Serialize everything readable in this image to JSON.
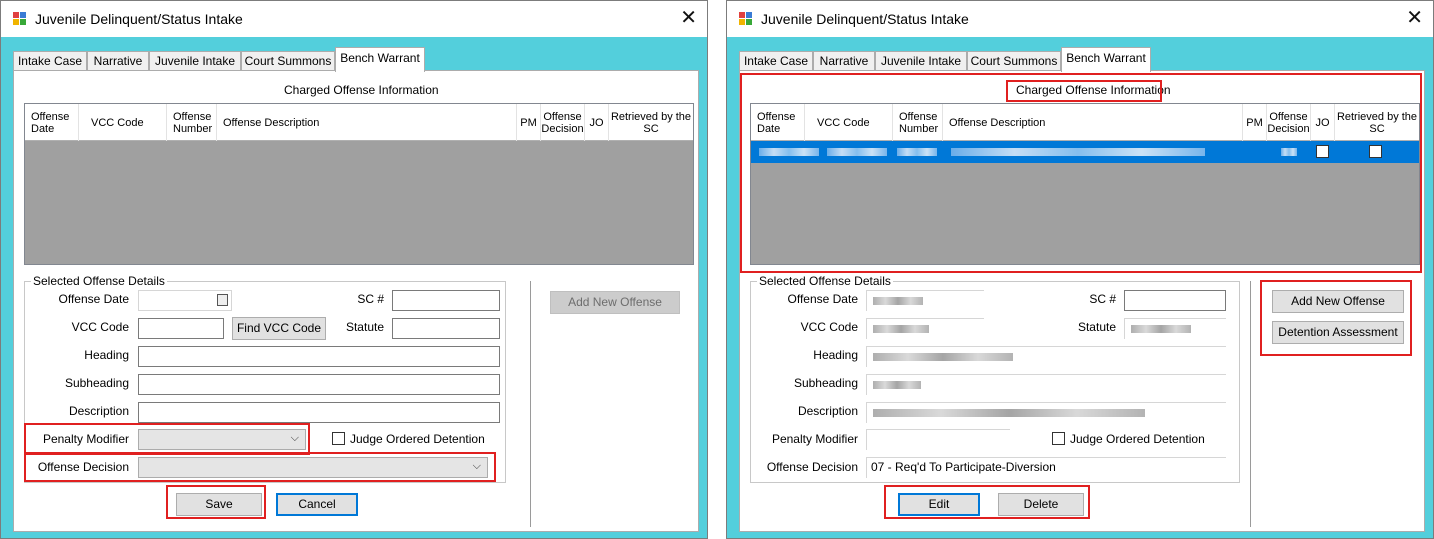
{
  "window_title": "Juvenile Delinquent/Status Intake",
  "close_glyph": "✕",
  "tabs": [
    "Intake Case",
    "Narrative",
    "Juvenile Intake",
    "Court Summons",
    "Bench Warrant"
  ],
  "active_tab": "Bench Warrant",
  "offense_group_title": "Charged Offense Information",
  "grid_columns": {
    "offense_date": "Offense Date",
    "vcc_code": "VCC Code",
    "offense_number": "Offense Number",
    "offense_description": "Offense Description",
    "pm": "PM",
    "offense_decision": "Offense Decision",
    "jo": "JO",
    "retrieved": "Retrieved by the SC"
  },
  "details_title": "Selected Offense Details",
  "labels": {
    "offense_date": "Offense Date",
    "sc_number": "SC #",
    "vcc_code": "VCC Code",
    "statute": "Statute",
    "heading": "Heading",
    "subheading": "Subheading",
    "description": "Description",
    "penalty_modifier": "Penalty Modifier",
    "judge_ordered_detention": "Judge Ordered Detention",
    "offense_decision": "Offense Decision"
  },
  "left": {
    "find_vcc_button": "Find VCC Code",
    "save_button": "Save",
    "cancel_button": "Cancel",
    "add_new_offense_button": "Add New Offense"
  },
  "right": {
    "offense_decision_value": "07 - Req'd To Participate-Diversion",
    "edit_button": "Edit",
    "delete_button": "Delete",
    "add_new_offense_button": "Add New Offense",
    "detention_assessment_button": "Detention Assessment"
  },
  "colors": {
    "window_bg": "#53cfdc",
    "selection": "#0078d7",
    "highlight": "#e02020",
    "grid_empty": "#a0a0a0"
  }
}
